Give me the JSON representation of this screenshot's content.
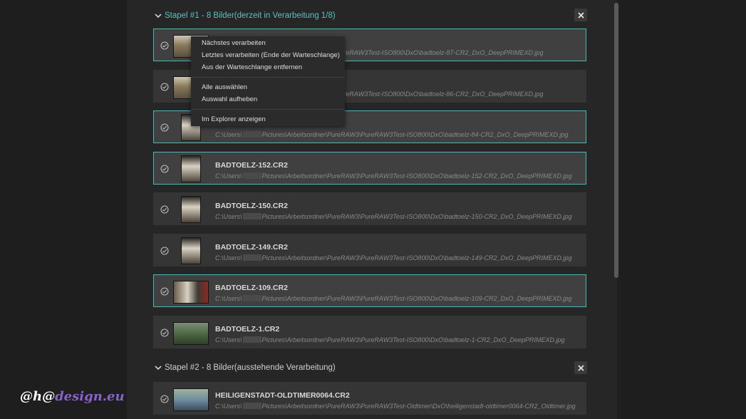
{
  "colors": {
    "accent": "#4fb6b4",
    "panel_bg": "#262626",
    "row_bg": "#353535",
    "row_selected_bg": "#404040",
    "watermark_white": "#ffffff",
    "watermark_purple": "#8a63c9"
  },
  "group1": {
    "title": "Stapel #1 - 8 Bilder(derzeit in Verarbeitung 1/8)",
    "title_color": "#56c3c1",
    "close_icon": "close-icon"
  },
  "group2": {
    "title": "Stapel #2 - 8 Bilder(ausstehende Verarbeitung)",
    "title_color": "#cfcfcf",
    "close_icon": "close-icon"
  },
  "rows": [
    {
      "name": "",
      "path_pre": "",
      "path_post": "PureRAW3\\PureRAW3Test-ISO800\\DxO\\badtoelz-87-CR2_DxO_DeepPRIMEXD.jpg",
      "selected": true
    },
    {
      "name": "",
      "path_pre": "",
      "path_post": "PureRAW3\\PureRAW3Test-ISO800\\DxO\\badtoelz-86-CR2_DxO_DeepPRIMEXD.jpg",
      "selected": false
    },
    {
      "name": "",
      "path_pre": "C:\\Users\\",
      "path_post": "Pictures\\Arbeitsordner\\PureRAW3\\PureRAW3Test-ISO800\\DxO\\badtoelz-84-CR2_DxO_DeepPRIMEXD.jpg",
      "selected": true
    },
    {
      "name": "BADTOELZ-152.CR2",
      "path_pre": "C:\\Users\\",
      "path_post": "Pictures\\Arbeitsordner\\PureRAW3\\PureRAW3Test-ISO800\\DxO\\badtoelz-152-CR2_DxO_DeepPRIMEXD.jpg",
      "selected": true
    },
    {
      "name": "BADTOELZ-150.CR2",
      "path_pre": "C:\\Users\\",
      "path_post": "Pictures\\Arbeitsordner\\PureRAW3\\PureRAW3Test-ISO800\\DxO\\badtoelz-150-CR2_DxO_DeepPRIMEXD.jpg",
      "selected": false
    },
    {
      "name": "BADTOELZ-149.CR2",
      "path_pre": "C:\\Users\\",
      "path_post": "Pictures\\Arbeitsordner\\PureRAW3\\PureRAW3Test-ISO800\\DxO\\badtoelz-149-CR2_DxO_DeepPRIMEXD.jpg",
      "selected": false
    },
    {
      "name": "BADTOELZ-109.CR2",
      "path_pre": "C:\\Users\\",
      "path_post": "Pictures\\Arbeitsordner\\PureRAW3\\PureRAW3Test-ISO800\\DxO\\badtoelz-109-CR2_DxO_DeepPRIMEXD.jpg",
      "selected": true
    },
    {
      "name": "BADTOELZ-1.CR2",
      "path_pre": "C:\\Users\\",
      "path_post": "Pictures\\Arbeitsordner\\PureRAW3\\PureRAW3Test-ISO800\\DxO\\badtoelz-1-CR2_DxO_DeepPRIMEXD.jpg",
      "selected": false
    },
    {
      "name": "HEILIGENSTADT-OLDTIMER0064.CR2",
      "path_pre": "C:\\Users\\",
      "path_post": "Pictures\\Arbeitsordner\\PureRAW3\\PureRAW3Test-Oldtimer\\DxO\\heiligenstadt-oldtimer0064-CR2_Oldtimer.jpg",
      "selected": false
    }
  ],
  "context_menu": {
    "next": "Nächstes verarbeiten",
    "last": "Letztes verarbeiten (Ende der Warteschlange)",
    "remove": "Aus der Warteschlange entfernen",
    "select_all": "Alle auswählen",
    "deselect": "Auswahl aufheben",
    "explorer": "Im Explorer anzeigen"
  },
  "watermark": {
    "part1": "@h@",
    "part2": "design.eu"
  }
}
